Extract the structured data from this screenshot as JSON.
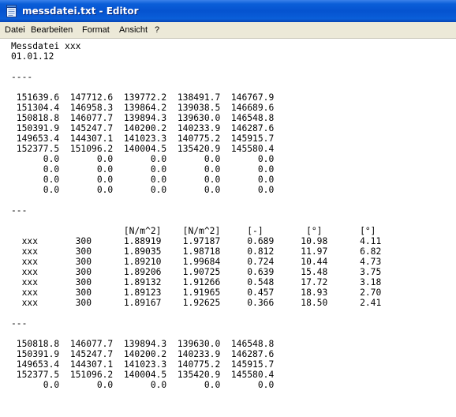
{
  "window": {
    "title": "messdatei.txt - Editor",
    "icon": "notepad-icon",
    "colors": {
      "titlebar": "#0553d0",
      "menubar": "#ece9d8",
      "editor_bg": "#ffffff"
    }
  },
  "menu": {
    "items": [
      "Datei",
      "Bearbeiten",
      "Format",
      "Ansicht",
      "?"
    ]
  },
  "document": {
    "lines": [
      "Messdatei xxx",
      "01.01.12",
      "",
      "----",
      "",
      " 151639.6  147712.6  139772.2  138491.7  146767.9",
      " 151304.4  146958.3  139864.2  139038.5  146689.6",
      " 150818.8  146077.7  139894.3  139630.0  146548.8",
      " 150391.9  145247.7  140200.2  140233.9  146287.6",
      " 149653.4  144307.1  141023.3  140775.2  145915.7",
      " 152377.5  151096.2  140004.5  135420.9  145580.4",
      "      0.0       0.0       0.0       0.0       0.0",
      "      0.0       0.0       0.0       0.0       0.0",
      "      0.0       0.0       0.0       0.0       0.0",
      "      0.0       0.0       0.0       0.0       0.0",
      "",
      "---",
      "",
      "                     [N/m^2]    [N/m^2]     [-]        [°]       [°]",
      "  xxx       300      1.88919    1.97187     0.689     10.98      4.11",
      "  xxx       300      1.89035    1.98718     0.812     11.97      6.82",
      "  xxx       300      1.89210    1.99684     0.724     10.44      4.73",
      "  xxx       300      1.89206    1.90725     0.639     15.48      3.75",
      "  xxx       300      1.89132    1.91266     0.548     17.72      3.18",
      "  xxx       300      1.89123    1.91965     0.457     18.93      2.70",
      "  xxx       300      1.89167    1.92625     0.366     18.50      2.41",
      "",
      "---",
      "",
      " 150818.8  146077.7  139894.3  139630.0  146548.8",
      " 150391.9  145247.7  140200.2  140233.9  146287.6",
      " 149653.4  144307.1  141023.3  140775.2  145915.7",
      " 152377.5  151096.2  140004.5  135420.9  145580.4",
      "      0.0       0.0       0.0       0.0       0.0"
    ]
  }
}
